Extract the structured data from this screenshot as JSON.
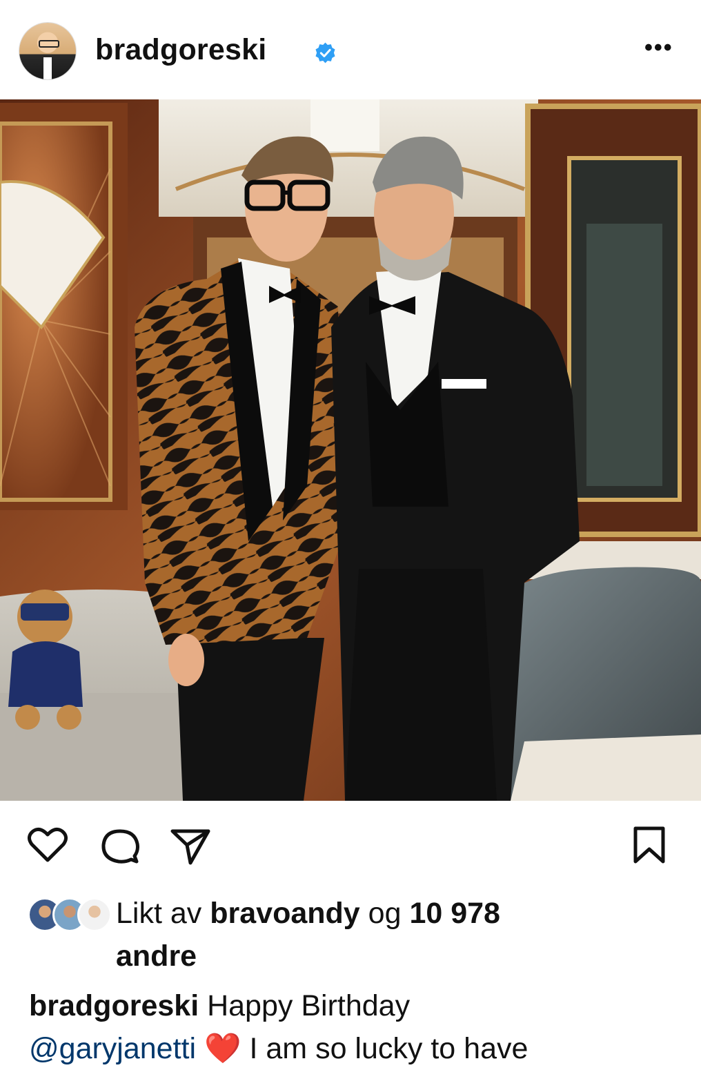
{
  "post": {
    "username": "bradgoreski",
    "verified": true,
    "more_label": "•••"
  },
  "photo": {
    "description_colors": {
      "wood": "#8b4a25",
      "brass": "#c9a35a",
      "velvet": "#6f7b7f"
    }
  },
  "actions": {
    "like_icon": "heart-outline-icon",
    "comment_icon": "comment-bubble-icon",
    "share_icon": "paper-plane-icon",
    "save_icon": "bookmark-outline-icon"
  },
  "likes": {
    "prefix": "Likt av",
    "user": "bravoandy",
    "og": "og",
    "count": "10 978",
    "suffix": "andre"
  },
  "caption": {
    "username": "bradgoreski",
    "text1": "Happy Birthday",
    "mention": "@garyjanetti",
    "emoji": "❤️",
    "text2": "I am so lucky to have"
  }
}
